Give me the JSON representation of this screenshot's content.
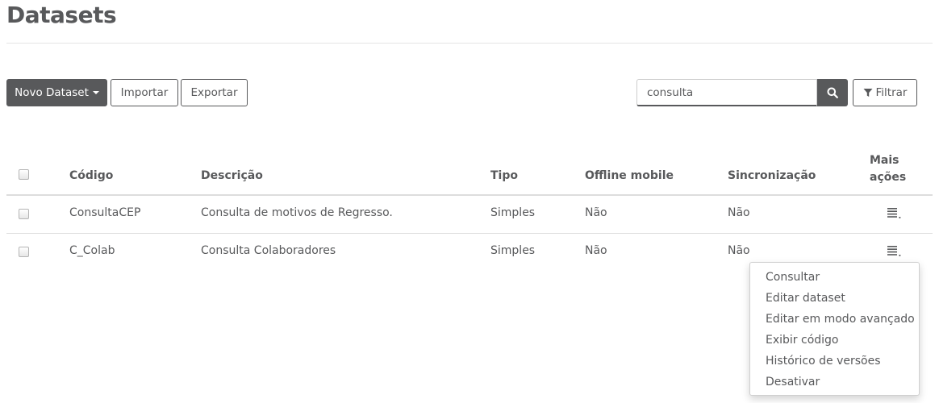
{
  "page": {
    "title": "Datasets"
  },
  "toolbar": {
    "new_label": "Novo Dataset",
    "import_label": "Importar",
    "export_label": "Exportar",
    "filter_label": "Filtrar"
  },
  "search": {
    "value": "consulta"
  },
  "table": {
    "headers": {
      "code": "Código",
      "description": "Descrição",
      "type": "Tipo",
      "offline": "Offline mobile",
      "sync": "Sincronização",
      "more_actions_line1": "Mais",
      "more_actions_line2": "ações"
    },
    "rows": [
      {
        "code": "ConsultaCEP",
        "description": "Consulta de motivos de Regresso.",
        "type": "Simples",
        "offline": "Não",
        "sync": "Não"
      },
      {
        "code": "C_Colab",
        "description": "Consulta Colaboradores",
        "type": "Simples",
        "offline": "Não",
        "sync": "Não"
      }
    ]
  },
  "actions_menu": {
    "items": [
      "Consultar",
      "Editar dataset",
      "Editar em modo avançado",
      "Exibir código",
      "Histórico de versões",
      "Desativar"
    ]
  },
  "icons": {
    "search": "search-icon",
    "filter": "filter-icon",
    "caret": "caret-down-icon",
    "row_menu": "list-menu-icon"
  },
  "colors": {
    "primary_dark": "#58595b",
    "text": "#58595b",
    "border": "#dddddd"
  }
}
